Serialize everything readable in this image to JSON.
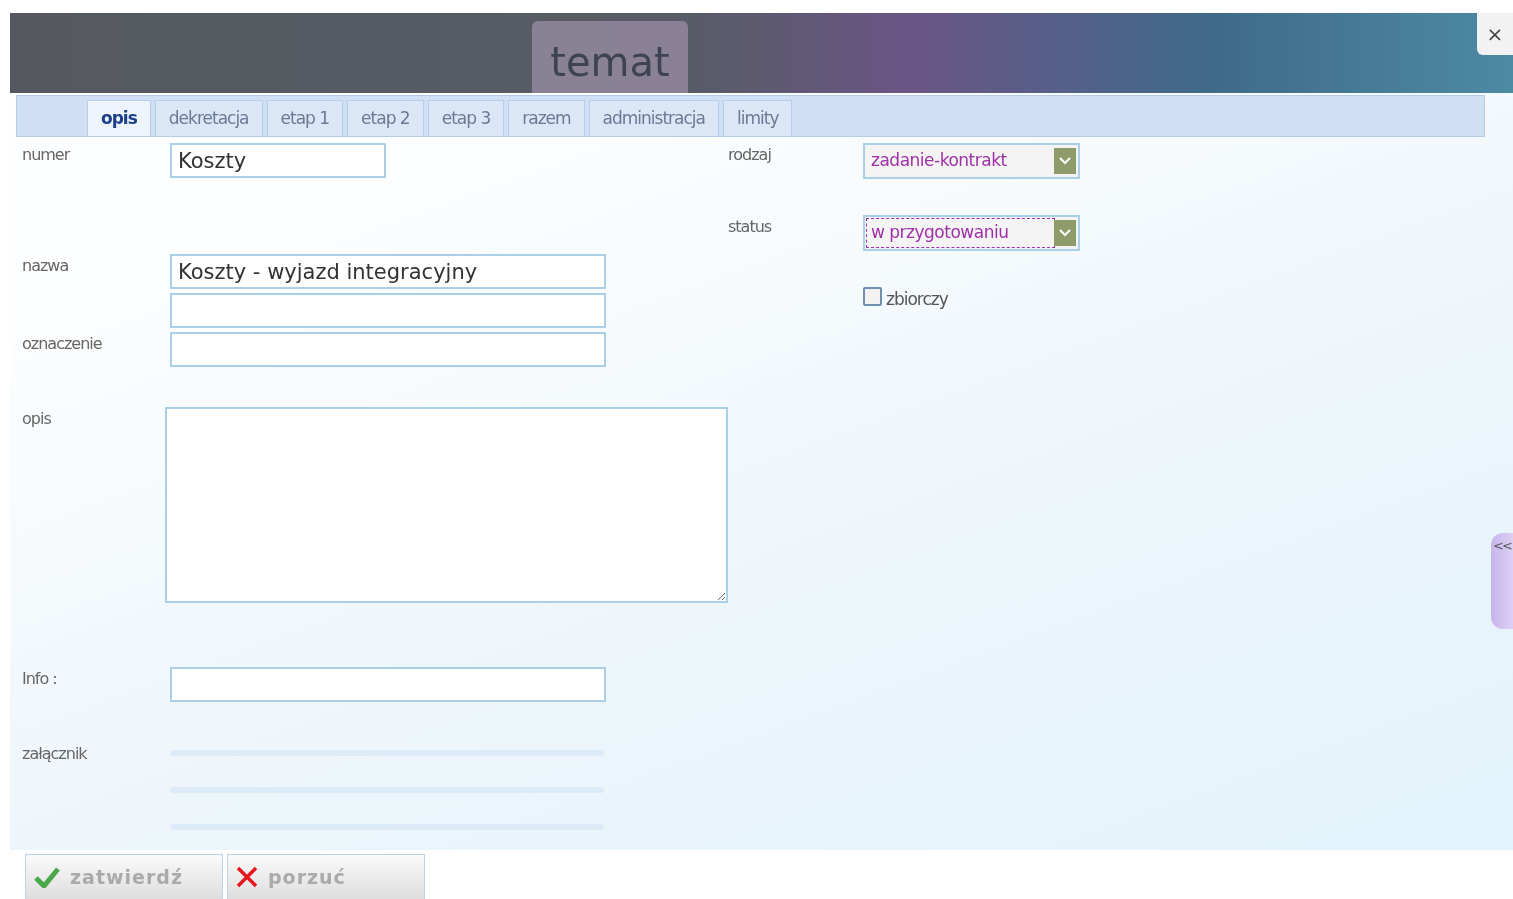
{
  "window": {
    "title": "temat",
    "close": "×"
  },
  "tabs": [
    {
      "label": "opis",
      "selected": true
    },
    {
      "label": "dekretacja",
      "selected": false
    },
    {
      "label": "etap 1",
      "selected": false
    },
    {
      "label": "etap 2",
      "selected": false
    },
    {
      "label": "etap 3",
      "selected": false
    },
    {
      "label": "razem",
      "selected": false
    },
    {
      "label": "administracja",
      "selected": false
    },
    {
      "label": "limity",
      "selected": false
    }
  ],
  "left_fields": [
    {
      "kind": "short_input",
      "label": "numer",
      "value": "Koszty"
    },
    {
      "kind": "input",
      "label": "nazwa",
      "value": "Koszty - wyjazd integracyjny"
    },
    {
      "kind": "input"
    },
    {
      "kind": "input",
      "label": "oznaczenie"
    },
    {
      "kind": "textarea",
      "label": "opis"
    },
    {
      "kind": "input",
      "label": "Info :"
    },
    {
      "kind": "attachment",
      "label": "załącznik"
    }
  ],
  "right_fields": [
    {
      "kind": "select",
      "label": "rodzaj",
      "value": "zadanie-kontrakt",
      "focused": false
    },
    {
      "kind": "select",
      "label": "status",
      "value": "w przygotowaniu",
      "focused": true
    },
    {
      "kind": "checkbox",
      "label": "zbiorczy",
      "checked": false
    }
  ],
  "side_tab": {
    "label": "<<"
  },
  "buttons": [
    {
      "kind": "confirm",
      "label": "zatwierdź"
    },
    {
      "kind": "cancel",
      "label": "porzuć"
    }
  ]
}
